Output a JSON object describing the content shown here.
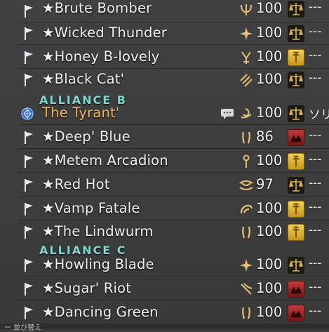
{
  "alliance_a_rows": [
    {
      "name": "★Brute Bomber",
      "level": "100",
      "job_icon": "warrior-icon",
      "role": "scale",
      "status": "---"
    },
    {
      "name": "★Wicked Thunder",
      "level": "100",
      "job_icon": "paladin-icon",
      "role": "scale",
      "status": "---"
    },
    {
      "name": "★Honey B-lovely",
      "level": "100",
      "job_icon": "astrologian-icon",
      "role": "gold",
      "status": "---"
    },
    {
      "name": "★Black Cat'",
      "level": "100",
      "job_icon": "ninja-icon",
      "role": "scale",
      "status": "---"
    }
  ],
  "alliance_b": {
    "header": "ALLIANCE B",
    "leader": {
      "name": "The Tyrant'",
      "level": "100",
      "job_icon": "dancer-icon",
      "role": "scale",
      "status": "ソリ"
    },
    "rows": [
      {
        "name": "★Deep' Blue",
        "level": "86",
        "job_icon": "dragoon-icon",
        "role": "red",
        "status": "---"
      },
      {
        "name": "★Metem Arcadion",
        "level": "100",
        "job_icon": "whitemage-icon",
        "role": "gold",
        "status": "---"
      },
      {
        "name": "★Red Hot",
        "level": "97",
        "job_icon": "reaper-icon",
        "role": "scale",
        "status": "---"
      },
      {
        "name": "★Vamp Fatale",
        "level": "100",
        "job_icon": "monk-icon",
        "role": "gold",
        "status": "---"
      },
      {
        "name": "★The Lindwurm",
        "level": "100",
        "job_icon": "dragoon-icon",
        "role": "gold",
        "status": "---"
      }
    ]
  },
  "alliance_c": {
    "header": "ALLIANCE C",
    "rows": [
      {
        "name": "★Howling Blade",
        "level": "100",
        "job_icon": "paladin-icon",
        "role": "scale",
        "status": "---"
      },
      {
        "name": "★Sugar' Riot",
        "level": "100",
        "job_icon": "bard-icon",
        "role": "red",
        "status": "---"
      },
      {
        "name": "★Dancing Green",
        "level": "100",
        "job_icon": "dragoon-icon",
        "role": "red",
        "status": "---"
      }
    ]
  },
  "footer": "ー 並び替え",
  "colors": {
    "leader_name": "#f1b35b",
    "header": "#7fd6d0",
    "flag": "#e9e9f5"
  }
}
